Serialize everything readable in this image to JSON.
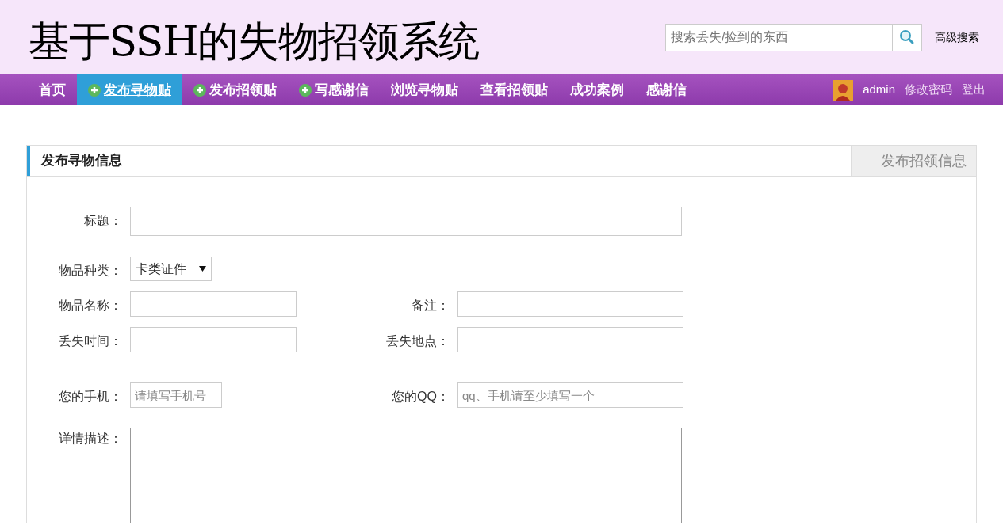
{
  "header": {
    "title": "基于SSH的失物招领系统",
    "search": {
      "placeholder": "搜索丢失/捡到的东西"
    },
    "advanced_search": "高级搜索"
  },
  "nav": {
    "items": [
      {
        "label": "首页",
        "kind": "plain",
        "selected": false
      },
      {
        "label": "发布寻物贴",
        "kind": "plus",
        "selected": true
      },
      {
        "label": "发布招领贴",
        "kind": "plus",
        "selected": false
      },
      {
        "label": "写感谢信",
        "kind": "plus",
        "selected": false
      },
      {
        "label": "浏览寻物贴",
        "kind": "plain",
        "selected": false
      },
      {
        "label": "查看招领贴",
        "kind": "plain",
        "selected": false
      },
      {
        "label": "成功案例",
        "kind": "plain",
        "selected": false
      },
      {
        "label": "感谢信",
        "kind": "plain",
        "selected": false
      }
    ],
    "user": "admin",
    "links": [
      "修改密码",
      "登出"
    ]
  },
  "panel": {
    "tabs": [
      {
        "label": "发布寻物信息",
        "selected": true
      },
      {
        "label": "发布招领信息",
        "selected": false
      }
    ],
    "rows": [
      [
        {
          "label": "标题：",
          "kind": "text"
        }
      ],
      [
        {
          "label": "物品种类：",
          "kind": "select",
          "value": "卡类证件"
        }
      ],
      [
        {
          "label": "物品名称：",
          "kind": "text"
        },
        {
          "label": "备注：",
          "kind": "text"
        }
      ],
      [
        {
          "label": "丢失时间：",
          "kind": "text"
        },
        {
          "label": "丢失地点：",
          "kind": "text"
        }
      ],
      [
        {
          "label": "您的手机：",
          "kind": "text",
          "placeholder": "请填写手机号"
        },
        {
          "label": "您的QQ：",
          "kind": "text",
          "placeholder": "qq、手机请至少填写一个"
        }
      ],
      [
        {
          "label": "详情描述：",
          "kind": "textarea"
        }
      ]
    ]
  }
}
